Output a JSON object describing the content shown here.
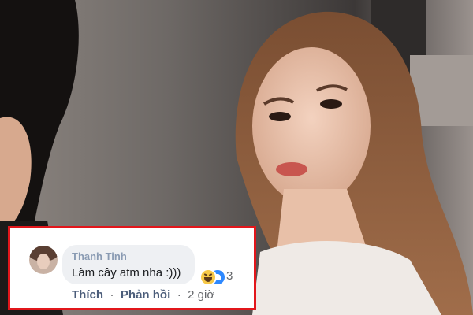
{
  "comment": {
    "author": "Thanh Tinh",
    "text": "Làm cây atm nha :)))",
    "reaction_count": "3",
    "reaction_icons": [
      "haha-emoji-icon",
      "like-icon"
    ],
    "actions": {
      "like_label": "Thích",
      "reply_label": "Phản hồi",
      "separator": "·",
      "timestamp": "2 giờ"
    }
  },
  "colors": {
    "highlight_border": "#e2161b",
    "author": "#8a9bb3",
    "action_text": "#4b5d7a",
    "bubble": "#eef0f3"
  }
}
